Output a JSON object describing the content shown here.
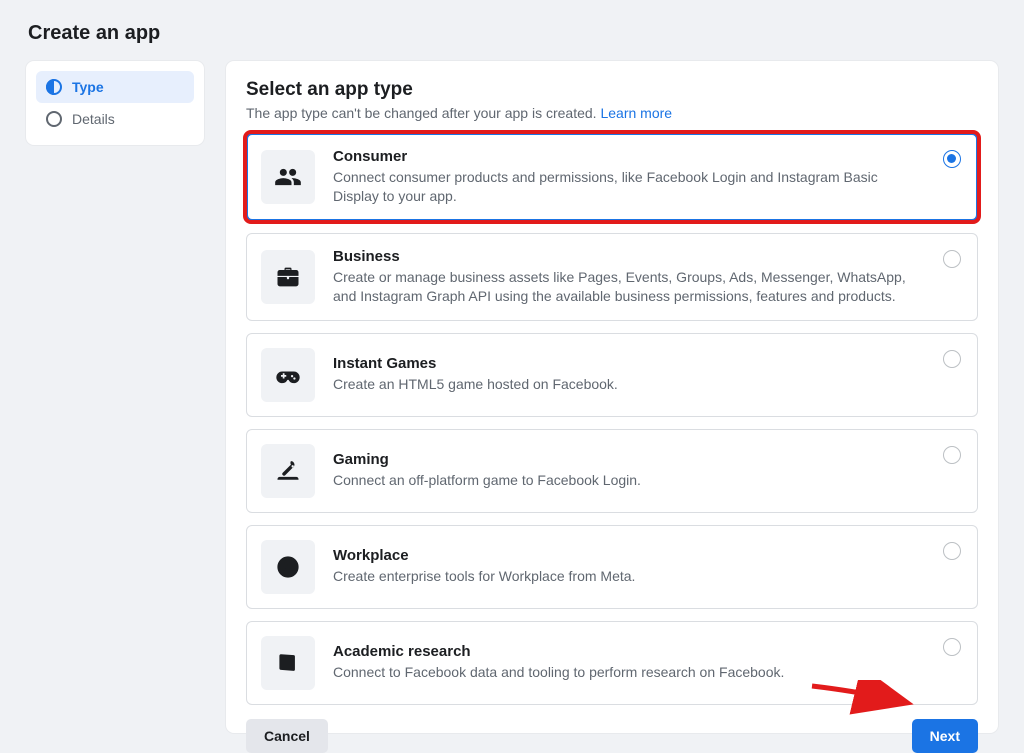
{
  "page_title": "Create an app",
  "sidebar": {
    "steps": [
      {
        "label": "Type",
        "active": true
      },
      {
        "label": "Details",
        "active": false
      }
    ]
  },
  "main": {
    "heading": "Select an app type",
    "subtitle_prefix": "The app type can't be changed after your app is created. ",
    "learn_more": "Learn more",
    "options": [
      {
        "key": "consumer",
        "title": "Consumer",
        "desc": "Connect consumer products and permissions, like Facebook Login and Instagram Basic Display to your app.",
        "selected": true,
        "highlighted": true,
        "icon": "users-icon"
      },
      {
        "key": "business",
        "title": "Business",
        "desc": "Create or manage business assets like Pages, Events, Groups, Ads, Messenger, WhatsApp, and Instagram Graph API using the available business permissions, features and products.",
        "selected": false,
        "highlighted": false,
        "icon": "briefcase-icon"
      },
      {
        "key": "instant-games",
        "title": "Instant Games",
        "desc": "Create an HTML5 game hosted on Facebook.",
        "selected": false,
        "highlighted": false,
        "icon": "gamepad-icon"
      },
      {
        "key": "gaming",
        "title": "Gaming",
        "desc": "Connect an off-platform game to Facebook Login.",
        "selected": false,
        "highlighted": false,
        "icon": "joystick-icon"
      },
      {
        "key": "workplace",
        "title": "Workplace",
        "desc": "Create enterprise tools for Workplace from Meta.",
        "selected": false,
        "highlighted": false,
        "icon": "workplace-icon"
      },
      {
        "key": "academic",
        "title": "Academic research",
        "desc": "Connect to Facebook data and tooling to perform research on Facebook.",
        "selected": false,
        "highlighted": false,
        "icon": "book-icon"
      }
    ]
  },
  "footer": {
    "cancel": "Cancel",
    "next": "Next"
  },
  "annotations": {
    "arrow_color": "#e21b1b"
  }
}
